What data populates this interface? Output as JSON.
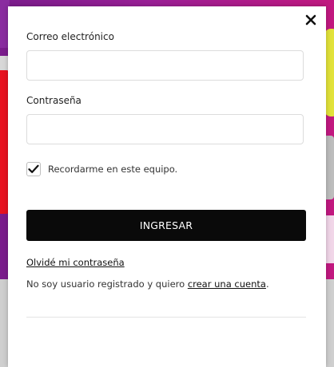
{
  "modal": {
    "email_label": "Correo electrónico",
    "email_value": "",
    "email_placeholder": "",
    "password_label": "Contraseña",
    "password_value": "",
    "password_placeholder": "",
    "remember_label": "Recordarme en este equipo.",
    "remember_checked": true,
    "submit_label": "INGRESAR",
    "forgot_link": "Olvidé mi contraseña",
    "register_prefix": "No soy usuario registrado y quiero ",
    "register_link": "crear una cuenta",
    "register_suffix": "."
  },
  "icons": {
    "close": "close-icon",
    "check": "checkmark-icon"
  },
  "colors": {
    "submit_bg": "#0a0a0a",
    "background_purple": "#9a1f96",
    "background_red": "#e8121f",
    "background_yellow": "#e2e23a"
  }
}
